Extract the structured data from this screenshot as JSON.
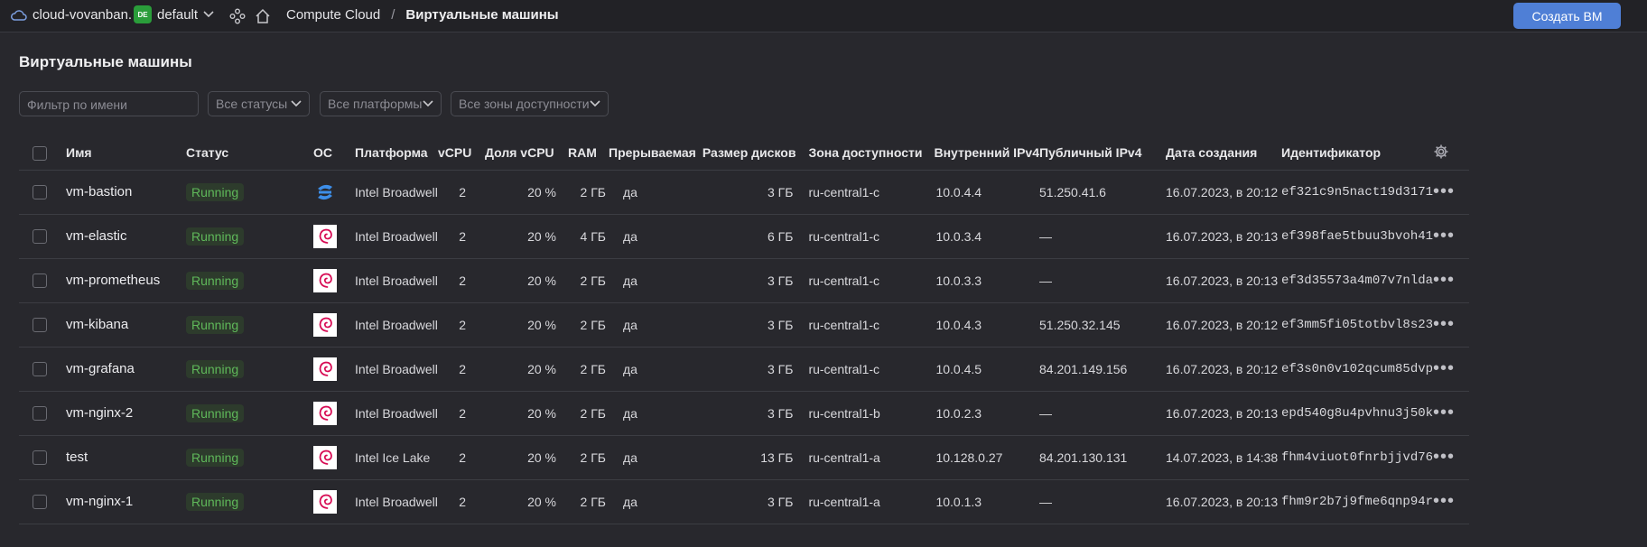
{
  "topbar": {
    "cloud_name": "cloud-vovanban...",
    "folder_badge": "DE",
    "folder_name": "default",
    "breadcrumb_service": "Compute Cloud",
    "breadcrumb_sep": "/",
    "breadcrumb_current": "Виртуальные машины",
    "create_button": "Создать ВМ"
  },
  "page": {
    "title": "Виртуальные машины"
  },
  "filters": {
    "name_placeholder": "Фильтр по имени",
    "status": "Все статусы",
    "platform": "Все платформы",
    "zone": "Все зоны доступности"
  },
  "table": {
    "columns": {
      "name": "Имя",
      "status": "Статус",
      "os": "ОС",
      "platform": "Платформа",
      "vcpu": "vCPU",
      "core_fraction": "Доля vCPU",
      "ram": "RAM",
      "preemptible": "Прерываемая",
      "disk": "Размер дисков",
      "zone": "Зона доступности",
      "internal_ip": "Внутренний IPv4",
      "public_ip": "Публичный IPv4",
      "created": "Дата создания",
      "id": "Идентификатор"
    },
    "rows": [
      {
        "name": "vm-bastion",
        "status": "Running",
        "os": "ubuntu-icon",
        "platform": "Intel Broadwell",
        "vcpu": "2",
        "core_fraction": "20 %",
        "ram": "2 ГБ",
        "preemptible": "да",
        "disk": "3 ГБ",
        "zone": "ru-central1-c",
        "internal_ip": "10.0.4.4",
        "public_ip": "51.250.41.6",
        "created": "16.07.2023, в 20:12",
        "id": "ef321c9n5nact19d3171"
      },
      {
        "name": "vm-elastic",
        "status": "Running",
        "os": "debian-icon",
        "platform": "Intel Broadwell",
        "vcpu": "2",
        "core_fraction": "20 %",
        "ram": "4 ГБ",
        "preemptible": "да",
        "disk": "6 ГБ",
        "zone": "ru-central1-c",
        "internal_ip": "10.0.3.4",
        "public_ip": "—",
        "created": "16.07.2023, в 20:13",
        "id": "ef398fae5tbuu3bvoh41"
      },
      {
        "name": "vm-prometheus",
        "status": "Running",
        "os": "debian-icon",
        "platform": "Intel Broadwell",
        "vcpu": "2",
        "core_fraction": "20 %",
        "ram": "2 ГБ",
        "preemptible": "да",
        "disk": "3 ГБ",
        "zone": "ru-central1-c",
        "internal_ip": "10.0.3.3",
        "public_ip": "—",
        "created": "16.07.2023, в 20:13",
        "id": "ef3d35573a4m07v7nlda"
      },
      {
        "name": "vm-kibana",
        "status": "Running",
        "os": "debian-icon",
        "platform": "Intel Broadwell",
        "vcpu": "2",
        "core_fraction": "20 %",
        "ram": "2 ГБ",
        "preemptible": "да",
        "disk": "3 ГБ",
        "zone": "ru-central1-c",
        "internal_ip": "10.0.4.3",
        "public_ip": "51.250.32.145",
        "created": "16.07.2023, в 20:12",
        "id": "ef3mm5fi05totbvl8s23"
      },
      {
        "name": "vm-grafana",
        "status": "Running",
        "os": "debian-icon",
        "platform": "Intel Broadwell",
        "vcpu": "2",
        "core_fraction": "20 %",
        "ram": "2 ГБ",
        "preemptible": "да",
        "disk": "3 ГБ",
        "zone": "ru-central1-c",
        "internal_ip": "10.0.4.5",
        "public_ip": "84.201.149.156",
        "created": "16.07.2023, в 20:12",
        "id": "ef3s0n0v102qcum85dvp"
      },
      {
        "name": "vm-nginx-2",
        "status": "Running",
        "os": "debian-icon",
        "platform": "Intel Broadwell",
        "vcpu": "2",
        "core_fraction": "20 %",
        "ram": "2 ГБ",
        "preemptible": "да",
        "disk": "3 ГБ",
        "zone": "ru-central1-b",
        "internal_ip": "10.0.2.3",
        "public_ip": "—",
        "created": "16.07.2023, в 20:13",
        "id": "epd540g8u4pvhnu3j50k"
      },
      {
        "name": "test",
        "status": "Running",
        "os": "debian-icon",
        "platform": "Intel Ice Lake",
        "vcpu": "2",
        "core_fraction": "20 %",
        "ram": "2 ГБ",
        "preemptible": "да",
        "disk": "13 ГБ",
        "zone": "ru-central1-a",
        "internal_ip": "10.128.0.27",
        "public_ip": "84.201.130.131",
        "created": "14.07.2023, в 14:38",
        "id": "fhm4viuot0fnrbjjvd76"
      },
      {
        "name": "vm-nginx-1",
        "status": "Running",
        "os": "debian-icon",
        "platform": "Intel Broadwell",
        "vcpu": "2",
        "core_fraction": "20 %",
        "ram": "2 ГБ",
        "preemptible": "да",
        "disk": "3 ГБ",
        "zone": "ru-central1-a",
        "internal_ip": "10.0.1.3",
        "public_ip": "—",
        "created": "16.07.2023, в 20:13",
        "id": "fhm9r2b7j9fme6qnp94r"
      }
    ]
  },
  "colors": {
    "background": "#28282d",
    "accent": "#4f7fd6",
    "status_running": "#5fb85a",
    "debian": "#d70a53",
    "ubuntu": "#3d8ee8"
  }
}
